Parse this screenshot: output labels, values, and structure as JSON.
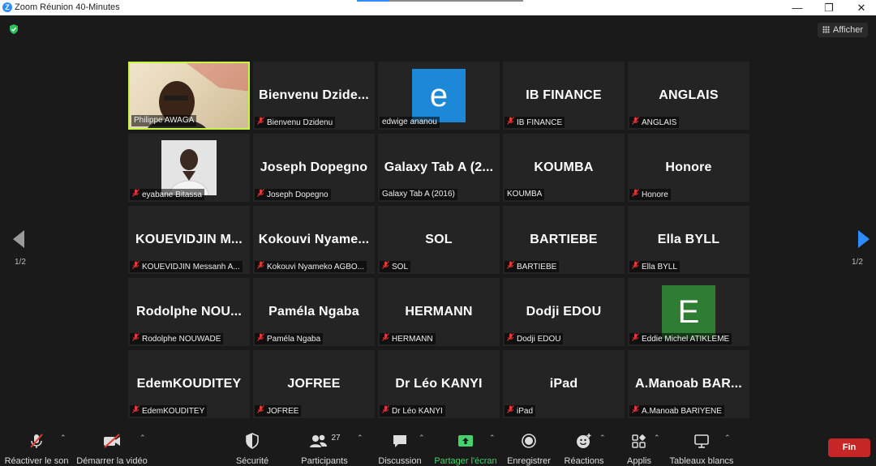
{
  "window": {
    "title": "Zoom Réunion 40-Minutes",
    "logo": "Z"
  },
  "top_right": {
    "afficher_label": "Afficher"
  },
  "pagination": {
    "left": "1/2",
    "right": "1/2"
  },
  "participants": [
    {
      "display": "",
      "label": "Philippe AWAGA",
      "muted": false,
      "video": true,
      "active": true
    },
    {
      "display": "Bienvenu  Dzide...",
      "label": "Bienvenu Dzidenu",
      "muted": true
    },
    {
      "display": "",
      "label": "edwige ananou",
      "muted": false,
      "avatar": "e",
      "avatar_color": "#1e88d8"
    },
    {
      "display": "IB FINANCE",
      "label": "IB FINANCE",
      "muted": true
    },
    {
      "display": "ANGLAIS",
      "label": "ANGLAIS",
      "muted": true
    },
    {
      "display": "",
      "label": "eyabane Bitassa",
      "muted": true,
      "video": true
    },
    {
      "display": "Joseph Dopegno",
      "label": "Joseph Dopegno",
      "muted": true
    },
    {
      "display": "Galaxy Tab A (2...",
      "label": "Galaxy Tab A (2016)",
      "muted": false
    },
    {
      "display": "KOUMBA",
      "label": "KOUMBA",
      "muted": false
    },
    {
      "display": "Honore",
      "label": "Honore",
      "muted": true
    },
    {
      "display": "KOUEVIDJIN  M...",
      "label": "KOUEVIDJIN Messanh A...",
      "muted": true
    },
    {
      "display": "Kokouvi  Nyame...",
      "label": "Kokouvi Nyameko AGBO...",
      "muted": true
    },
    {
      "display": "SOL",
      "label": "SOL",
      "muted": true
    },
    {
      "display": "BARTIEBE",
      "label": "BARTIEBE",
      "muted": true
    },
    {
      "display": "Ella BYLL",
      "label": "Ella BYLL",
      "muted": true
    },
    {
      "display": "Rodolphe  NOU...",
      "label": "Rodolphe NOUWADE",
      "muted": true
    },
    {
      "display": "Paméla Ngaba",
      "label": "Paméla Ngaba",
      "muted": true
    },
    {
      "display": "HERMANN",
      "label": "HERMANN",
      "muted": true
    },
    {
      "display": "Dodji EDOU",
      "label": "Dodji EDOU",
      "muted": true
    },
    {
      "display": "",
      "label": "Eddie Michel ATIKLEME",
      "muted": true,
      "avatar": "E",
      "avatar_color": "#2e7d32"
    },
    {
      "display": "EdemKOUDITEY",
      "label": "EdemKOUDITEY",
      "muted": true
    },
    {
      "display": "JOFREE",
      "label": "JOFREE",
      "muted": true
    },
    {
      "display": "Dr Léo KANYI",
      "label": "Dr Léo KANYI",
      "muted": true
    },
    {
      "display": "iPad",
      "label": "iPad",
      "muted": true
    },
    {
      "display": "A.Manoab   BAR...",
      "label": "A.Manoab  BARIYENE",
      "muted": true
    }
  ],
  "toolbar": {
    "unmute": "Réactiver le son",
    "start_video": "Démarrer la vidéo",
    "security": "Sécurité",
    "participants": "Participants",
    "participants_count": "27",
    "chat": "Discussion",
    "share": "Partager l'écran",
    "record": "Enregistrer",
    "reactions": "Réactions",
    "apps": "Applis",
    "whiteboards": "Tableaux blancs",
    "end": "Fin"
  },
  "colors": {
    "accent": "#2d8cff",
    "share_green": "#45d16e",
    "end_red": "#c72626",
    "active_border": "#c8f542"
  }
}
